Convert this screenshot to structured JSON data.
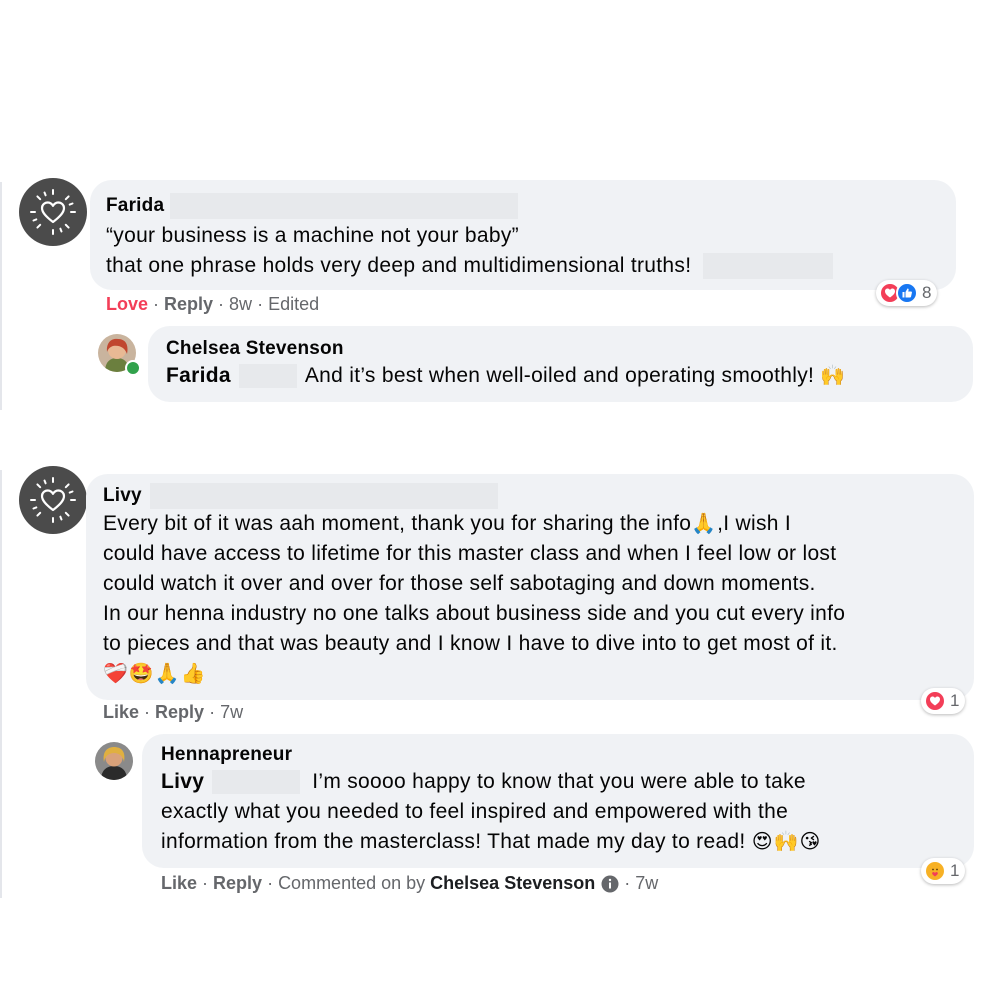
{
  "comments": [
    {
      "author": "Farida",
      "lines": [
        "“your business is a machine not your baby”",
        "that one phrase holds very deep and multidimensional truths!"
      ],
      "actions": {
        "reaction": "Love",
        "reply": "Reply",
        "time": "8w",
        "edited": "Edited"
      },
      "reaction_count": "8"
    },
    {
      "author": "Livy",
      "lines": [
        "Every bit of it was aah moment, thank you for sharing the info",
        ",I wish I",
        "could have access to lifetime for this master class and when I feel low or lost",
        "could watch it over and over for those self sabotaging and down moments.",
        "In our henna industry no one talks about business side and you cut every info",
        "to pieces and that was beauty and I know I have to dive into to get most of it."
      ],
      "emoji_line": "❤️‍🩹🤩🙏👍",
      "inline_emoji": "🙏",
      "actions": {
        "like": "Like",
        "reply": "Reply",
        "time": "7w"
      },
      "reaction_count": "1"
    }
  ],
  "replies": [
    {
      "author": "Chelsea Stevenson",
      "mention": "Farida",
      "text": "And it’s best when well-oiled and operating smoothly!",
      "emoji": "🙌"
    },
    {
      "author": "Hennapreneur",
      "mention": "Livy",
      "lines": [
        "I’m soooo happy to know that you were able to take",
        "exactly what you needed to feel inspired and empowered with the",
        "information from the masterclass! That made my day to read!"
      ],
      "emoji": "😍🙌😘",
      "actions": {
        "like": "Like",
        "reply": "Reply",
        "commented_on_by": "Commented on by",
        "commenter": "Chelsea Stevenson",
        "time": "7w"
      },
      "reaction_count": "1"
    }
  ],
  "colors": {
    "love": "#f33e58",
    "like_blue": "#1877f2",
    "bubble": "#f0f2f5",
    "meta": "#65676b"
  },
  "icons": {
    "avatar_mark": "heart-sun-icon",
    "love_reaction": "heart-icon",
    "like_reaction": "thumbs-up-icon",
    "care_reaction": "care-icon",
    "info": "info-icon"
  }
}
